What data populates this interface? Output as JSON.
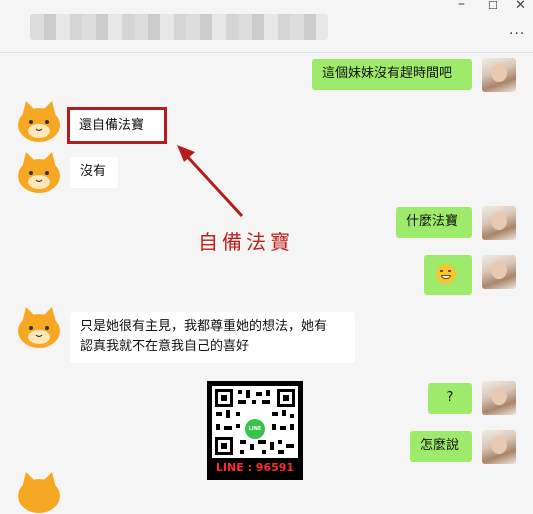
{
  "window": {
    "minimize_icon": "minimize-icon",
    "maximize_icon": "maximize-icon",
    "close_icon": "close-icon",
    "more_icon": "more-dots-icon",
    "minimize_glyph": "–",
    "maximize_glyph": "☐",
    "close_glyph": "✕",
    "more_glyph": "···"
  },
  "messages": [
    {
      "side": "out",
      "text": "這個妹妹沒有趕時間吧"
    },
    {
      "side": "in",
      "text": "還自備法寶"
    },
    {
      "side": "in",
      "text": "沒有"
    },
    {
      "side": "out",
      "text": "什麼法寶"
    },
    {
      "side": "out",
      "text": "",
      "emoji": "grinning-face-icon"
    },
    {
      "side": "in",
      "text": "只是她很有主見，我都尊重她的想法，她有"
    },
    {
      "side": "in",
      "text": "認真我就不在意我自己的喜好"
    },
    {
      "side": "out",
      "text": "?"
    },
    {
      "side": "out",
      "text": "怎麼說"
    }
  ],
  "annotation": {
    "text": "自備法寶",
    "color": "#c0201d"
  },
  "qr": {
    "label": "LINE : 96591",
    "badge": "LINE"
  },
  "colors": {
    "outgoing": "#9eea6a",
    "incoming": "#ffffff",
    "highlight": "#b21d1d",
    "background": "#f5f5f5"
  }
}
